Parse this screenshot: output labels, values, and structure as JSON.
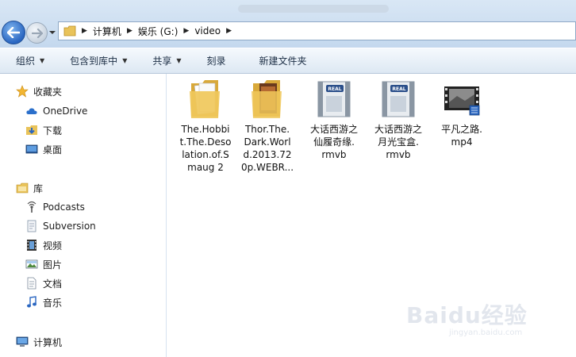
{
  "window": {
    "title_blurred": true
  },
  "nav_buttons": {
    "back": "back",
    "forward": "forward"
  },
  "address": {
    "crumbs": [
      "计算机",
      "娱乐 (G:)",
      "video"
    ]
  },
  "toolbar": {
    "items": [
      {
        "label": "组织",
        "dropdown": true
      },
      {
        "label": "包含到库中",
        "dropdown": true
      },
      {
        "label": "共享",
        "dropdown": true
      },
      {
        "label": "刻录",
        "dropdown": false
      },
      {
        "label": "新建文件夹",
        "dropdown": false
      }
    ]
  },
  "sidebar": {
    "favorites": {
      "label": "收藏夹",
      "items": [
        "OneDrive",
        "下载",
        "桌面"
      ]
    },
    "libraries": {
      "label": "库",
      "items": [
        "Podcasts",
        "Subversion",
        "视频",
        "图片",
        "文档",
        "音乐"
      ]
    },
    "computer": {
      "label": "计算机"
    }
  },
  "files": [
    {
      "name": "The.Hobbit.The.Desolation.of.Smaug 2",
      "lines": [
        "The.Hobbi",
        "t.The.Deso",
        "lation.of.S",
        "maug 2"
      ],
      "type": "folder-doc"
    },
    {
      "name": "Thor.The.Dark.World.2013.720p.WEBR...",
      "lines": [
        "Thor.The.",
        "Dark.Worl",
        "d.2013.72",
        "0p.WEBR..."
      ],
      "type": "folder-movie"
    },
    {
      "name": "大话西游之仙履奇缘.rmvb",
      "lines": [
        "大话西游之",
        "仙履奇缘.",
        "rmvb"
      ],
      "type": "real",
      "badge": "REAL"
    },
    {
      "name": "大话西游之月光宝盒.rmvb",
      "lines": [
        "大话西游之",
        "月光宝盒.",
        "rmvb"
      ],
      "type": "real",
      "badge": "REAL"
    },
    {
      "name": "平凡之路.mp4",
      "lines": [
        "平凡之路.",
        "mp4"
      ],
      "type": "video"
    }
  ],
  "watermark": {
    "text": "Baidu经验",
    "sub": "jingyan.baidu.com"
  },
  "colors": {
    "accent": "#2a66c1",
    "toolbar_text": "#1b2d44",
    "nav_bg": "#ffffff"
  }
}
